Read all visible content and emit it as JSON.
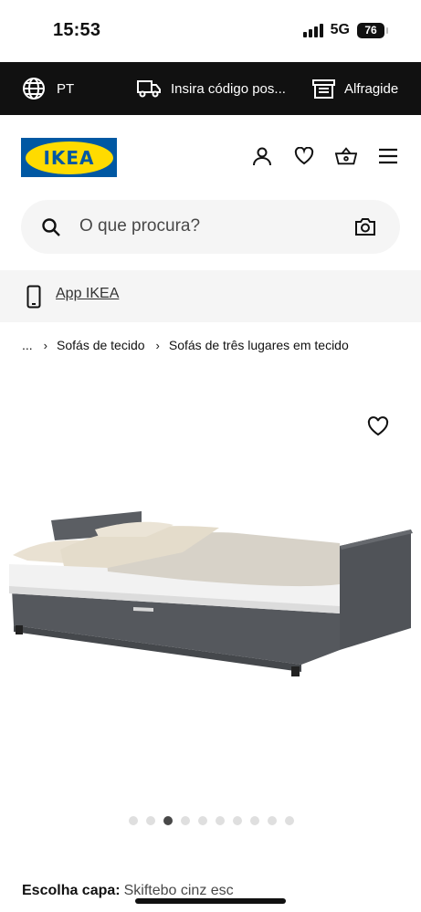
{
  "status": {
    "time": "15:53",
    "network": "5G",
    "battery": "76"
  },
  "topbar": {
    "language": "PT",
    "postcode_placeholder": "Insira código pos...",
    "store": "Alfragide"
  },
  "header": {
    "logo": "IKEA"
  },
  "search": {
    "placeholder": "O que procura?"
  },
  "app_banner": {
    "label": "App IKEA"
  },
  "breadcrumb": {
    "ellipsis": "...",
    "items": [
      "Sofás de tecido",
      "Sofás de três lugares em tecido"
    ]
  },
  "gallery": {
    "total_images": 10,
    "active_index": 2
  },
  "cover": {
    "label": "Escolha capa:",
    "value": "Skiftebo cinz esc"
  },
  "colors": {
    "brand_blue": "#0058a3",
    "brand_yellow": "#ffdb00",
    "topbar": "#111111"
  }
}
